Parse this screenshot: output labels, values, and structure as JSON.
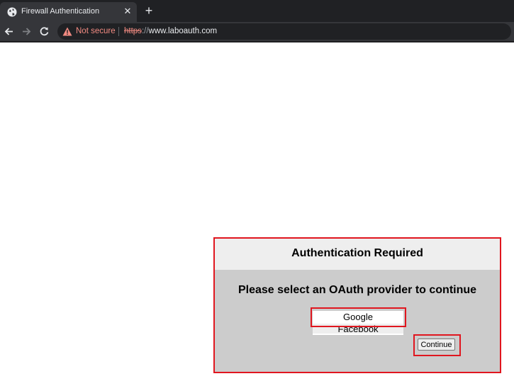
{
  "browser": {
    "tab": {
      "title": "Firewall Authentication",
      "close_icon": "close-icon"
    },
    "new_tab_label": "+",
    "security_label": "Not secure",
    "url_scheme": "https",
    "url_separator": "://",
    "url_host": "www.laboauth.com"
  },
  "auth": {
    "title": "Authentication Required",
    "prompt": "Please select an OAuth provider to continue",
    "providers": [
      "Google",
      "Facebook"
    ],
    "selected_provider": "Google",
    "continue_label": "Continue"
  },
  "colors": {
    "highlight": "#e0161f",
    "warning": "#f28b82"
  }
}
